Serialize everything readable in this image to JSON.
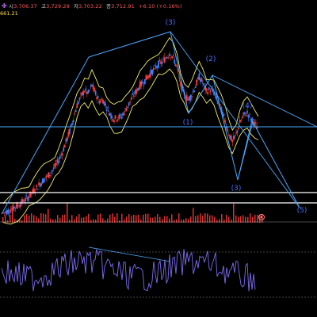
{
  "header": {
    "open_label": "시",
    "open": "3,706.37",
    "high_label": "고",
    "high": "3,729.29",
    "low_label": "저",
    "low": "3,703.22",
    "close_label": "종",
    "close": "3,712.91",
    "change": "+6.10 (+0.16%)",
    "ma_value": "661.21"
  },
  "colors": {
    "background": "#000000",
    "candle_up": "#ff3b3b",
    "candle_down": "#3b7bff",
    "bollinger": "#f0ee6a",
    "trendline": "#4aa8ff",
    "horizontal_line": "#ffffff",
    "wave_label": "#4a6cff",
    "volume": "#ff3b3b",
    "rsi_line": "#7b6cf0"
  },
  "chart_data": {
    "type": "line",
    "panels": [
      "price",
      "volume",
      "rsi"
    ],
    "series": [
      {
        "values": [
          2220,
          2235,
          2250,
          2275,
          2290,
          2320,
          2345,
          2380,
          2420,
          2460,
          2500,
          2540,
          2570,
          2610,
          2660,
          2720,
          2800,
          2900,
          3000,
          3120,
          3250,
          3330,
          3390,
          3360,
          3440,
          3360,
          3290,
          3300,
          3230,
          3160,
          3120,
          3130,
          3140,
          3200,
          3260,
          3330,
          3380,
          3440,
          3470,
          3520,
          3560,
          3600,
          3640,
          3660,
          3700,
          3745,
          3700,
          3610,
          3440,
          3360,
          3300,
          3350,
          3430,
          3520,
          3460,
          3380,
          3400,
          3370,
          3280,
          3200,
          3100,
          2980,
          2900,
          2970,
          3080,
          3150,
          3180,
          3120,
          3070,
          3030
        ]
      }
    ],
    "annotations": {
      "wave_labels": [
        "(3)",
        "(1)",
        "(2)",
        "(4)",
        "(3)",
        "(5)"
      ],
      "price_label": "661.21"
    },
    "horizontal_lines_count": 3,
    "grid": false
  }
}
